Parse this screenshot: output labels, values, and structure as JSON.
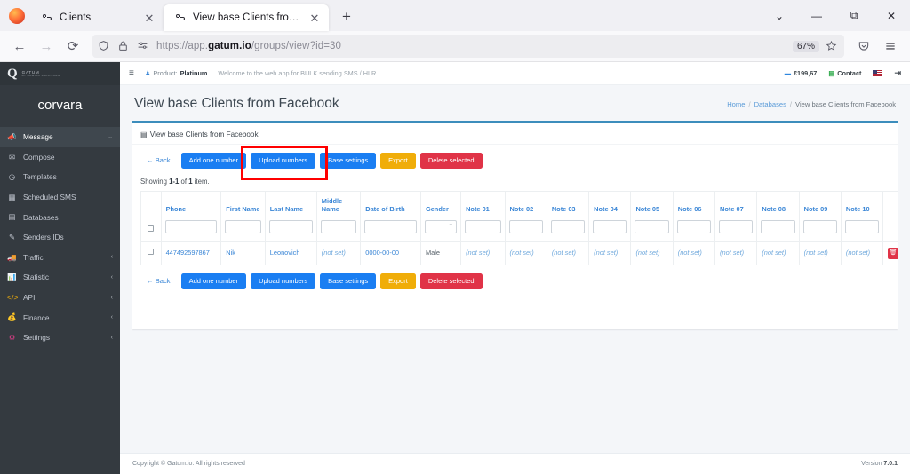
{
  "browser": {
    "tabs": [
      {
        "title": "Clients",
        "favicon": "gatum-icon",
        "active": false
      },
      {
        "title": "View base Clients from Faceboo",
        "favicon": "gatum-icon",
        "active": true
      }
    ],
    "new_tab_label": "+",
    "window_controls": {
      "list_all_tabs": "⌄",
      "minimize": "—",
      "maximize": "⧉",
      "close": "✕"
    },
    "nav": {
      "back": "←",
      "forward": "→",
      "reload": "⟳"
    },
    "url": {
      "prefix": "https://app.",
      "domain": "gatum.io",
      "suffix": "/groups/view?id=30"
    },
    "zoom_level": "67%",
    "bookmark_icon": "star-icon",
    "shield_icon": "shield-icon",
    "lock_icon": "lock-icon",
    "permissions_icon": "sliders-icon",
    "pocket_icon": "pocket-icon",
    "menu_icon": "hamburger-icon"
  },
  "sidebar": {
    "brand": {
      "mark": "Q",
      "line1": "GATUM",
      "line2": "BY DOMICO SOLUTIONS"
    },
    "username": "corvara",
    "items": [
      {
        "label": "Message",
        "icon": "megaphone-icon",
        "active": true,
        "caret": "chevron-down"
      },
      {
        "label": "Compose",
        "icon": "envelope-icon",
        "active": false,
        "caret": ""
      },
      {
        "label": "Templates",
        "icon": "clock-icon",
        "active": false,
        "caret": ""
      },
      {
        "label": "Scheduled SMS",
        "icon": "calendar-icon",
        "active": false,
        "caret": ""
      },
      {
        "label": "Databases",
        "icon": "clipboard-icon",
        "active": false,
        "caret": ""
      },
      {
        "label": "Senders IDs",
        "icon": "feather-icon",
        "active": false,
        "caret": ""
      },
      {
        "label": "Traffic",
        "icon": "truck-icon",
        "active": false,
        "caret": "chevron-left"
      },
      {
        "label": "Statistic",
        "icon": "chart-icon",
        "active": false,
        "caret": "chevron-left"
      },
      {
        "label": "API",
        "icon": "code-icon",
        "active": false,
        "caret": "chevron-left"
      },
      {
        "label": "Finance",
        "icon": "money-icon",
        "active": false,
        "caret": "chevron-left"
      },
      {
        "label": "Settings",
        "icon": "gear-icon",
        "active": false,
        "caret": "chevron-left"
      }
    ]
  },
  "topbar": {
    "menu_toggle": "≡",
    "product_label": "Product:",
    "product_value": "Platinum",
    "welcome": "Welcome to the web app for BULK sending SMS / HLR",
    "balance": "€199,67",
    "contact": "Contact",
    "language_flag": "us-flag-icon",
    "logout": "logout-icon"
  },
  "page": {
    "title": "View base Clients from Facebook",
    "breadcrumb": [
      {
        "label": "Home",
        "link": true
      },
      {
        "label": "Databases",
        "link": true
      },
      {
        "label": "View base Clients from Facebook",
        "link": false
      }
    ],
    "card_title": "View base Clients from Facebook",
    "card_icon": "clipboard-icon",
    "showing": {
      "prefix": "Showing ",
      "range": "1-1",
      "mid": " of ",
      "total": "1",
      "suffix": " item."
    }
  },
  "actions": {
    "back": "← Back",
    "add_one_number": "Add one number",
    "upload_numbers": "Upload numbers",
    "base_settings": "Base settings",
    "export": "Export",
    "delete_selected": "Delete selected"
  },
  "table": {
    "columns": [
      "Phone",
      "First Name",
      "Last Name",
      "Middle Name",
      "Date of Birth",
      "Gender",
      "Note 01",
      "Note 02",
      "Note 03",
      "Note 04",
      "Note 05",
      "Note 06",
      "Note 07",
      "Note 08",
      "Note 09",
      "Note 10"
    ],
    "filters": [
      "input",
      "input",
      "input",
      "input",
      "input",
      "select",
      "input",
      "input",
      "input",
      "input",
      "input",
      "input",
      "input",
      "input",
      "input",
      "input"
    ],
    "rows": [
      {
        "checkbox": false,
        "cells": [
          "447492597867",
          "Nik",
          "Leonovich",
          "(not set)",
          "0000-00-00",
          "Male",
          "(not set)",
          "(not set)",
          "(not set)",
          "(not set)",
          "(not set)",
          "(not set)",
          "(not set)",
          "(not set)",
          "(not set)",
          "(not set)"
        ],
        "delete_icon": "trash-icon"
      }
    ]
  },
  "footer": {
    "copyright": "Copyright © Gatum.io. All rights reserved",
    "version_label": "Version ",
    "version_value": "7.0.1"
  },
  "highlight": {
    "target": "upload-numbers-button",
    "color": "#ff0000"
  }
}
